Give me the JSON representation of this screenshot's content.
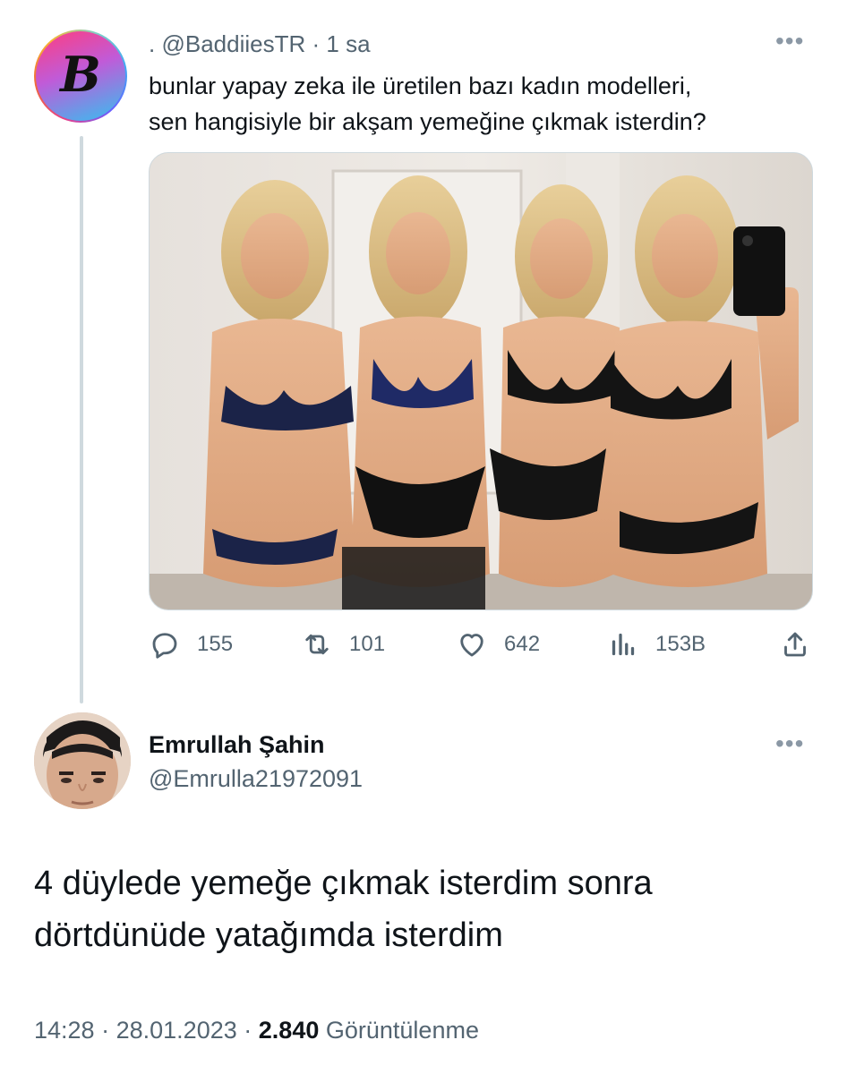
{
  "tweet": {
    "avatar_letter": "B",
    "prefix": ".",
    "handle": "@BaddiiesTR",
    "separator": "·",
    "time": "1 sa",
    "more": "•••",
    "text_line1": "bunlar yapay zeka ile üretilen bazı kadın modelleri,",
    "text_line2": "sen hangisiyle bir akşam yemeğine çıkmak isterdin?",
    "stats": {
      "replies": "155",
      "retweets": "101",
      "likes": "642",
      "views": "153B"
    }
  },
  "reply": {
    "name": "Emrullah Şahin",
    "handle": "@Emrulla21972091",
    "more": "•••",
    "text_line1": "4 düylede yemeğe çıkmak isterdim sonra",
    "text_line2": "dörtdünüde yatağımda isterdim",
    "time": "14:28",
    "separator": "·",
    "date": "28.01.2023",
    "view_count": "2.840",
    "view_label": "Görüntülenme"
  },
  "colors": {
    "text": "#0f1419",
    "secondary": "#536471",
    "thread_line": "#cfd9de"
  },
  "icons": [
    "reply-icon",
    "retweet-icon",
    "like-icon",
    "views-icon",
    "share-icon",
    "more-icon"
  ]
}
